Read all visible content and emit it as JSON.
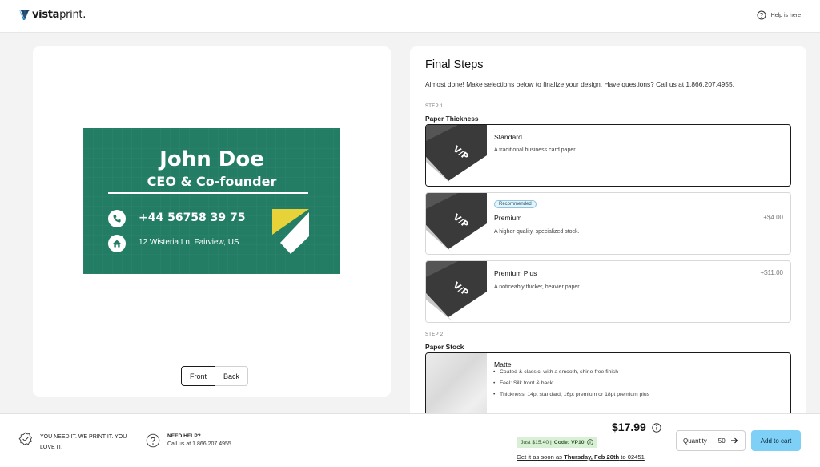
{
  "header": {
    "logo_bold": "vista",
    "logo_light": "print.",
    "help_label": "Help is here"
  },
  "preview": {
    "card": {
      "name": "John Doe",
      "role": "CEO & Co-founder",
      "phone": "+44 56758 39 75",
      "address": "12 Wisteria Ln, Fairview, US",
      "background_color": "#237d65",
      "accent_color": "#e7d23a"
    },
    "front_label": "Front",
    "back_label": "Back"
  },
  "steps": {
    "title": "Final Steps",
    "intro": "Almost done! Make selections below to finalize your design. Have questions? Call us at 1.866.207.4955.",
    "step1": {
      "label": "STEP 1",
      "title": "Paper Thickness",
      "options": [
        {
          "name": "Standard",
          "desc": "A traditional business card paper.",
          "price": "",
          "badge": "",
          "selected": true
        },
        {
          "name": "Premium",
          "desc": "A higher-quality, specialized stock.",
          "price": "+$4.00",
          "badge": "Recommended",
          "selected": false
        },
        {
          "name": "Premium Plus",
          "desc": "A noticeably thicker, heavier paper.",
          "price": "+$11.00",
          "badge": "",
          "selected": false
        }
      ]
    },
    "step2": {
      "label": "STEP 2",
      "title": "Paper Stock",
      "options": [
        {
          "name": "Matte",
          "bullets": [
            "Coated & classic, with a smooth, shine-free finish",
            "Feel: Silk front & back",
            "Thickness: 14pt standard, 16pt premium or 18pt premium plus"
          ],
          "selected": true
        }
      ]
    }
  },
  "footer": {
    "promise": "YOU NEED IT. WE PRINT IT. YOU LOVE IT.",
    "need_help_title": "NEED HELP?",
    "need_help_phone": "Call us at 1.866.207.4955",
    "price": "$17.99",
    "promo_price": "Just $15.40 |",
    "promo_code": "Code: VP10",
    "delivery_prefix": "Get it as soon as",
    "delivery_date": "Thursday, Feb 20th",
    "delivery_to": "to 02451",
    "quantity_label": "Quantity",
    "quantity_value": "50",
    "cart_label": "Add to cart",
    "cart_color": "#7fd0f7",
    "promo_color": "#d9efd6"
  }
}
